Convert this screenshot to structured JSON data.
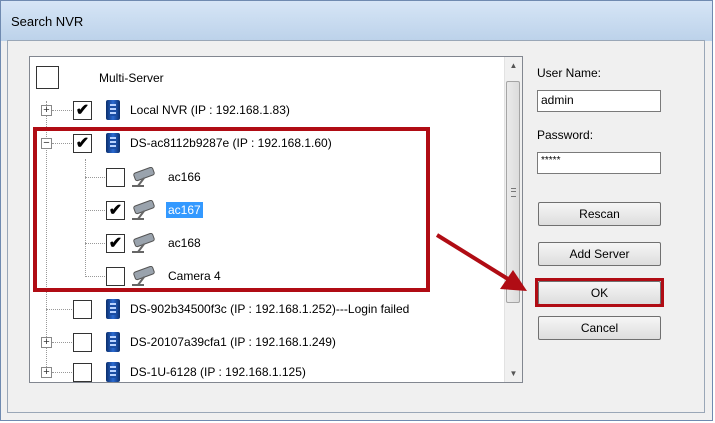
{
  "window": {
    "title": "Search NVR"
  },
  "tree": {
    "root_label": "Multi-Server",
    "rows": [
      {
        "label": "Local NVR (IP : 192.168.1.83)",
        "checked": true,
        "expander": "+"
      },
      {
        "label": "DS-ac8112b9287e (IP : 192.168.1.60)",
        "checked": true,
        "expander": "−"
      },
      {
        "label": "ac166",
        "checked": false
      },
      {
        "label": "ac167",
        "checked": true,
        "selected": true
      },
      {
        "label": "ac168",
        "checked": true
      },
      {
        "label": "Camera 4",
        "checked": false
      },
      {
        "label": "DS-902b34500f3c (IP : 192.168.1.252)---Login failed",
        "checked": false
      },
      {
        "label": "DS-20107a39cfa1 (IP : 192.168.1.249)",
        "checked": false,
        "expander": "+"
      },
      {
        "label": "DS-1U-6128 (IP : 192.168.1.125)",
        "checked": false,
        "expander": "+"
      }
    ]
  },
  "form": {
    "username_label": "User Name:",
    "username_value": "admin",
    "password_label": "Password:",
    "password_value": "*****"
  },
  "buttons": {
    "rescan": "Rescan",
    "add_server": "Add Server",
    "ok": "OK",
    "cancel": "Cancel"
  },
  "colors": {
    "highlight": "#b00c14",
    "selection": "#3399ff"
  },
  "icons": {
    "server": "nvr-server-icon",
    "camera": "camera-icon",
    "check": "✔"
  }
}
